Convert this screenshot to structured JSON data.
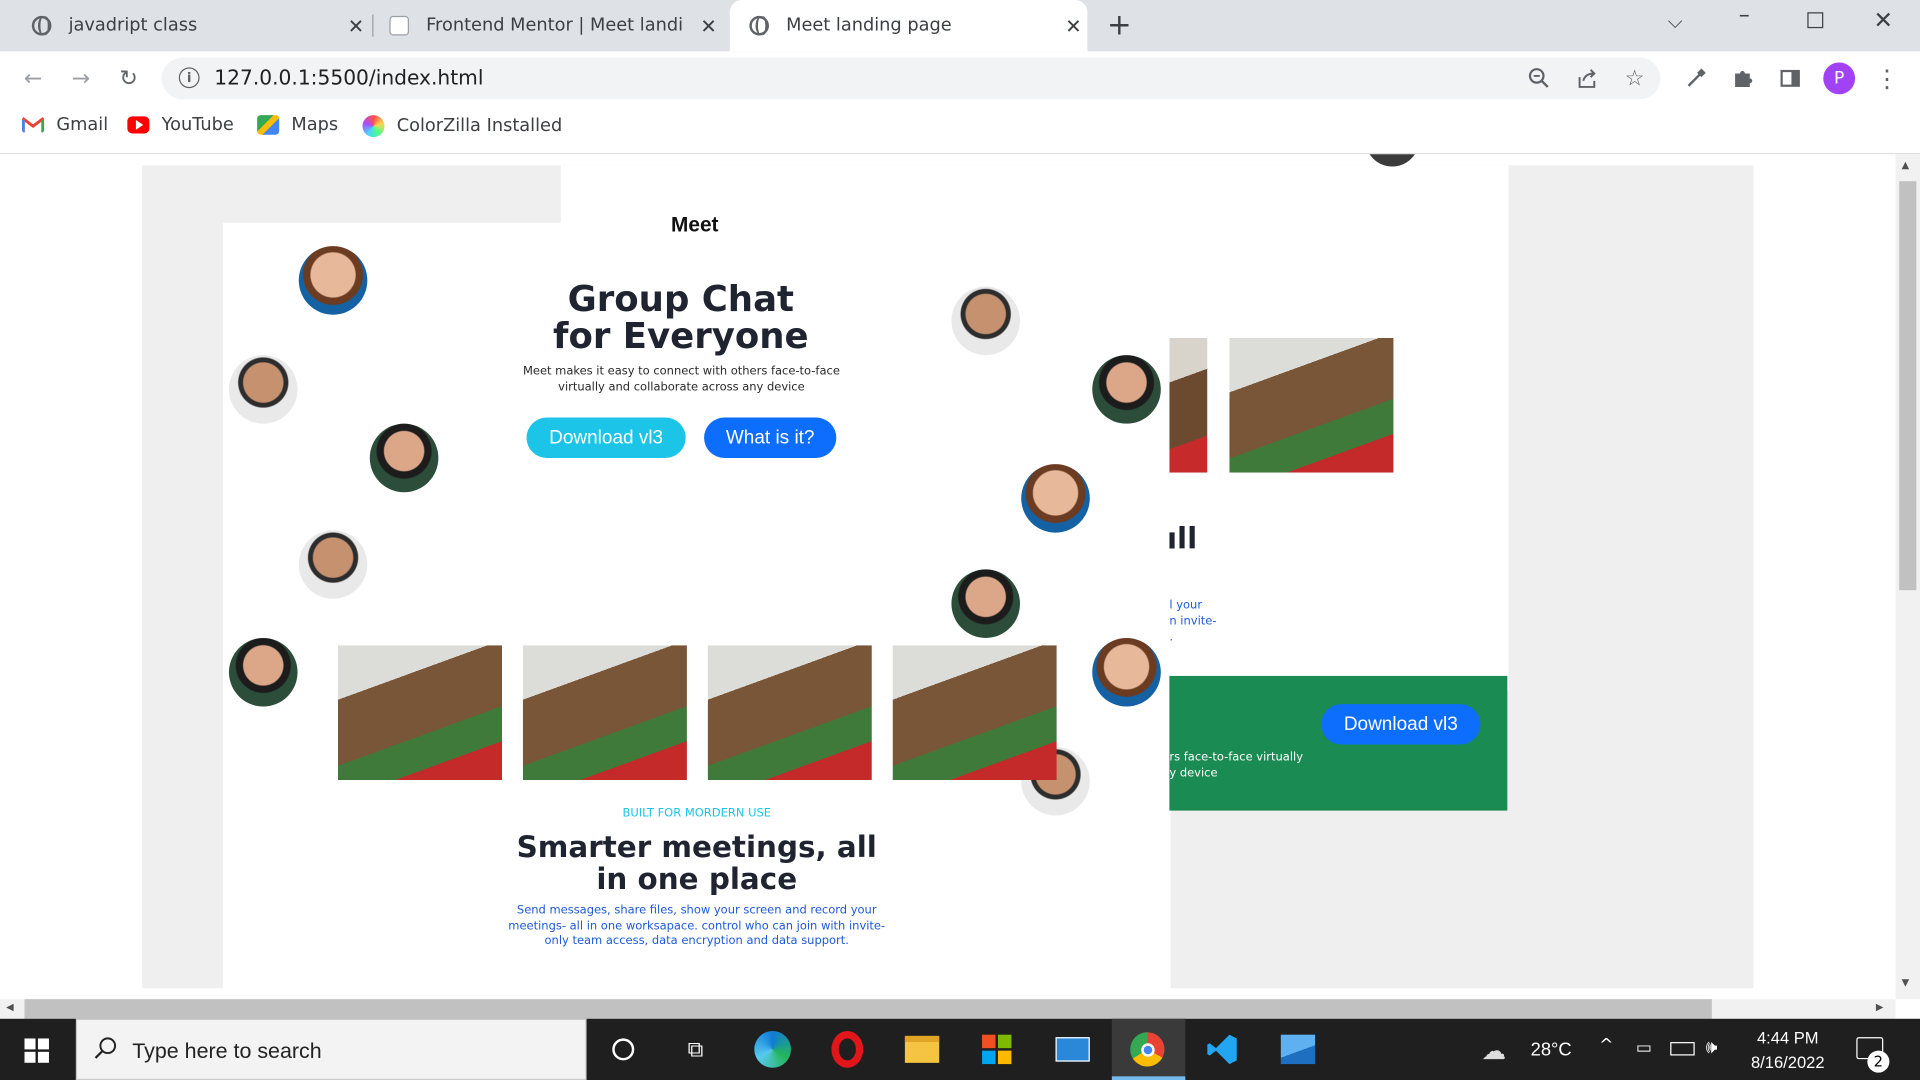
{
  "browser": {
    "tabs": [
      {
        "title": "javadript class"
      },
      {
        "title": "Frontend Mentor | Meet landing"
      },
      {
        "title": "Meet landing page"
      }
    ],
    "url": "127.0.0.1:5500/index.html",
    "bookmarks": [
      {
        "label": "Gmail"
      },
      {
        "label": "YouTube"
      },
      {
        "label": "Maps"
      },
      {
        "label": "ColorZilla Installed"
      }
    ],
    "profile_initial": "P"
  },
  "page": {
    "brand": "Meet",
    "hero": {
      "title_line1": "Group Chat",
      "title_line2": "for Everyone",
      "desc_line1": "Meet makes it easy to connect with others face-to-face",
      "desc_line2": "virtually and collaborate across any device",
      "primary_button": "Download vl3",
      "secondary_button": "What is it?"
    },
    "features": {
      "eyebrow": "BUILT FOR MORDERN USE",
      "title_line1": "Smarter meetings, all",
      "title_line2": "in one place",
      "desc_line1": "Send messages, share files, show your screen and record your",
      "desc_line2": "meetings- all in one worksapace. control who can join with invite-",
      "desc_line3": "only team access, data encryption and data support."
    },
    "clipped": {
      "heading_fragment": "ıll",
      "desc_frag1": "l your",
      "desc_frag2": "n invite-",
      "desc_frag3": ".",
      "cta_frag1": "rs face-to-face virtually",
      "cta_frag2": "y device",
      "cta_button": "Download vl3"
    }
  },
  "taskbar": {
    "search_placeholder": "Type here to search",
    "weather": "28°C",
    "time": "4:44 PM",
    "date": "8/16/2022",
    "notifications": "2"
  },
  "colors": {
    "cyan": "#1cc5e8",
    "blue": "#0d6efd",
    "green": "#1a8b52",
    "ink": "#1f2430",
    "link": "#1e5bd6"
  }
}
